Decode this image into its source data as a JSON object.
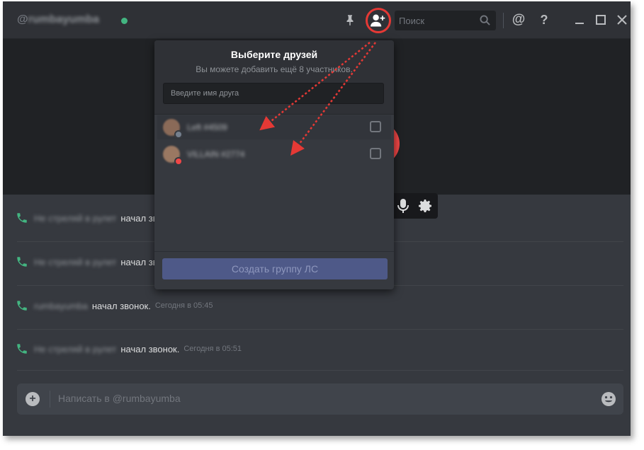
{
  "header": {
    "at_symbol": "@",
    "username": "rumbayumba",
    "search_placeholder": "Поиск",
    "mention_glyph": "@",
    "help_glyph": "?",
    "status_color": "#43b581"
  },
  "icons": {
    "pin": "pin-icon",
    "add_friend": "add-friend-icon",
    "search": "search-icon",
    "minimize": "minimize-icon",
    "maximize": "maximize-icon",
    "close": "close-icon",
    "mic": "microphone-icon",
    "settings": "gear-icon",
    "phone": "phone-icon",
    "plus": "plus-icon",
    "emoji": "emoji-icon"
  },
  "popup": {
    "title": "Выберите друзей",
    "subtitle": "Вы можете добавить ещё 8 участников.",
    "input_placeholder": "Введите имя друга",
    "friends": [
      {
        "name": "Left #4509"
      },
      {
        "name": "VILLAIN #2774"
      }
    ],
    "create_button": "Создать группу ЛС"
  },
  "messages": [
    {
      "author": "Не стреляй в рулет",
      "text": "начал звонок.",
      "time": ""
    },
    {
      "author": "Не стреляй в рулет",
      "text": "начал звонок.",
      "time": ""
    },
    {
      "author": "rumbayumba",
      "text": "начал звонок.",
      "time": "Сегодня в 05:45"
    },
    {
      "author": "Не стреляй в рулет",
      "text": "начал звонок.",
      "time": "Сегодня в 05:51"
    }
  ],
  "composer": {
    "placeholder": "Написать в @rumbayumba",
    "plus_glyph": "+"
  },
  "colors": {
    "background": "#36393f",
    "header": "#2f3136",
    "call_area": "#202225",
    "accent_green": "#43b581",
    "annotation_red": "#e53935",
    "create_button": "#4e5988"
  }
}
